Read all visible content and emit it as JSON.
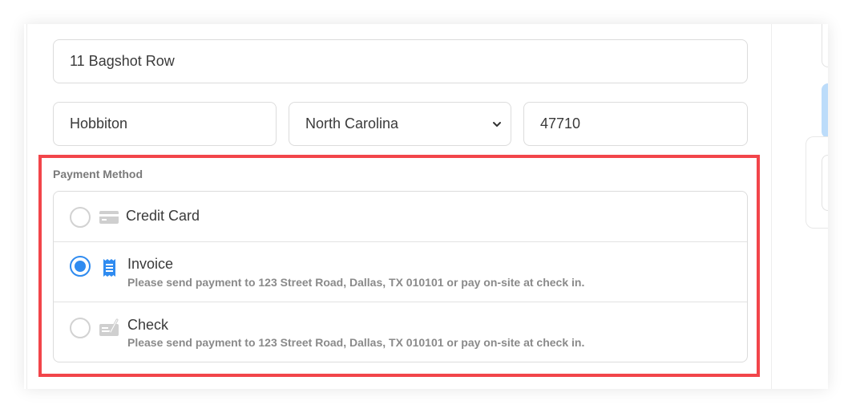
{
  "address": {
    "street_value": "11 Bagshot Row",
    "city_value": "Hobbiton",
    "state_value": "North Carolina",
    "zip_value": "47710"
  },
  "payment": {
    "label": "Payment Method",
    "options": [
      {
        "title": "Credit Card",
        "description": "",
        "icon": "credit-card-icon",
        "selected": false
      },
      {
        "title": "Invoice",
        "description": "Please send payment to 123 Street Road, Dallas, TX 010101 or pay on-site at check in.",
        "icon": "receipt-icon",
        "selected": true
      },
      {
        "title": "Check",
        "description": "Please send payment to 123 Street Road, Dallas, TX 010101 or pay on-site at check in.",
        "icon": "check-icon",
        "selected": false
      }
    ]
  },
  "colors": {
    "accent": "#2f8bf0",
    "highlight": "#f2454a",
    "border": "#dcdcdc",
    "muted_text": "#8a8a8a"
  }
}
